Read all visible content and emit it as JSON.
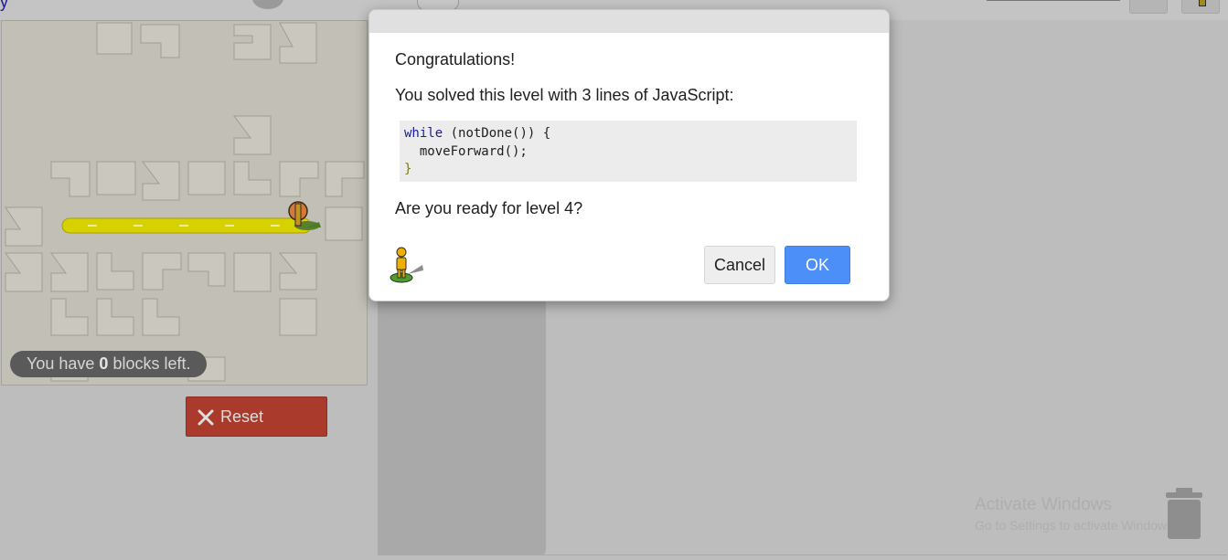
{
  "header": {
    "title_fragment": "y"
  },
  "maze": {
    "blocks_left_prefix": "You have ",
    "blocks_left_count": "0",
    "blocks_left_suffix": " blocks left."
  },
  "controls": {
    "reset_label": "Reset",
    "reset_icon": "close-x-icon"
  },
  "dialog": {
    "title": "Congratulations!",
    "solved_message": "You solved this level with 3 lines of JavaScript:",
    "code": {
      "line1_keyword": "while",
      "line1_rest": " (notDone()) {",
      "line2": "  moveForward();",
      "line3": "}"
    },
    "next_prompt": "Are you ready for level 4?",
    "cancel_label": "Cancel",
    "ok_label": "OK",
    "avatar_icon": "pegman-icon"
  },
  "watermark": {
    "title": "Activate Windows",
    "subtitle": "Go to Settings to activate Windows."
  },
  "colors": {
    "ok_button": "#4c8ff8",
    "reset_button": "#a93a2c",
    "path": "#d8d100",
    "code_keyword": "#1a1aa6"
  }
}
